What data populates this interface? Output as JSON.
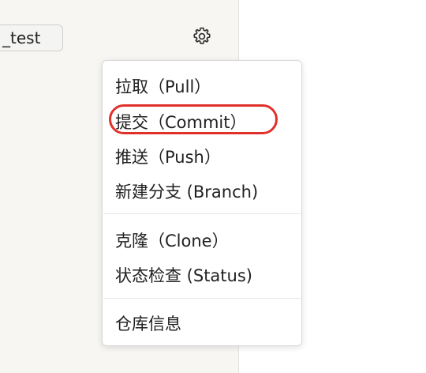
{
  "repo_label": "_test",
  "settings_icon": "gear-icon",
  "menu": {
    "items": [
      {
        "label": "拉取（Pull）"
      },
      {
        "label": "提交（Commit）"
      },
      {
        "label": "推送（Push）"
      },
      {
        "label": "新建分支 (Branch)"
      },
      {
        "label": "克隆（Clone）"
      },
      {
        "label": "状态检查 (Status)"
      },
      {
        "label": "仓库信息"
      }
    ]
  },
  "highlight_color": "#e0302a"
}
